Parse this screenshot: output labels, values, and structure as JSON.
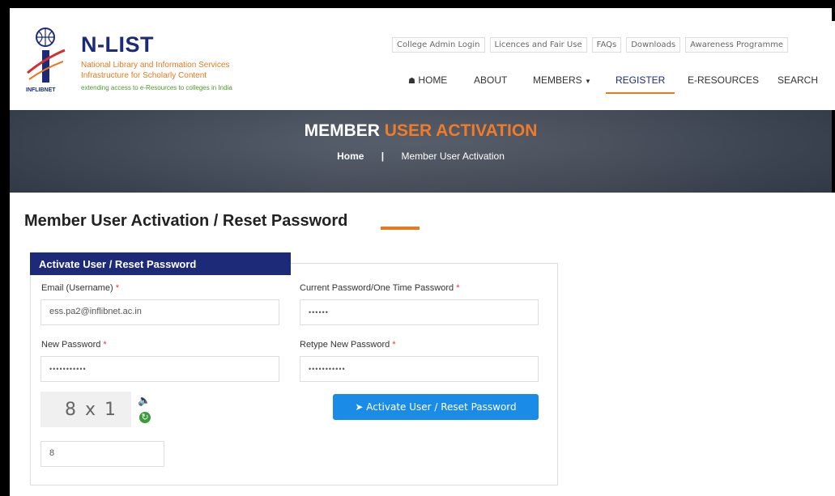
{
  "brand": {
    "title": "N-LIST",
    "sub1": "National Library and Information Services",
    "sub2": "Infrastructure for Scholarly Content",
    "sub3": "extending access to e-Resources to colleges in India",
    "logo_text": "INFLIBNET"
  },
  "top_links": [
    "College Admin Login",
    "Licences and Fair Use",
    "FAQs",
    "Downloads",
    "Awareness Programme"
  ],
  "nav": {
    "home": "HOME",
    "about": "ABOUT",
    "members": "MEMBERS",
    "register": "REGISTER",
    "eresources": "E-RESOURCES",
    "search": "SEARCH"
  },
  "banner": {
    "title_a": "MEMBER",
    "title_b": "USER ACTIVATION",
    "crumb_home": "Home",
    "crumb_sep": "|",
    "crumb_current": "Member User Activation"
  },
  "page_title": "Member User Activation / Reset Password",
  "panel_tab": "Activate User / Reset Password",
  "form": {
    "email_label": "Email (Username)",
    "email_value": "ess.pa2@inflibnet.ac.in",
    "current_label": "Current Password/One Time Password",
    "current_value": "••••••",
    "new_label": "New Password",
    "new_value": "•••••••••••",
    "retype_label": "Retype New Password",
    "retype_value": "•••••••••••",
    "required_mark": "*",
    "captcha_text": "8 x 1",
    "captcha_answer": "8",
    "submit_label": "Activate User / Reset Password"
  },
  "colors": {
    "brand_blue": "#1c2a78",
    "accent_orange": "#e57a1e",
    "button_blue": "#1a8ce8"
  }
}
